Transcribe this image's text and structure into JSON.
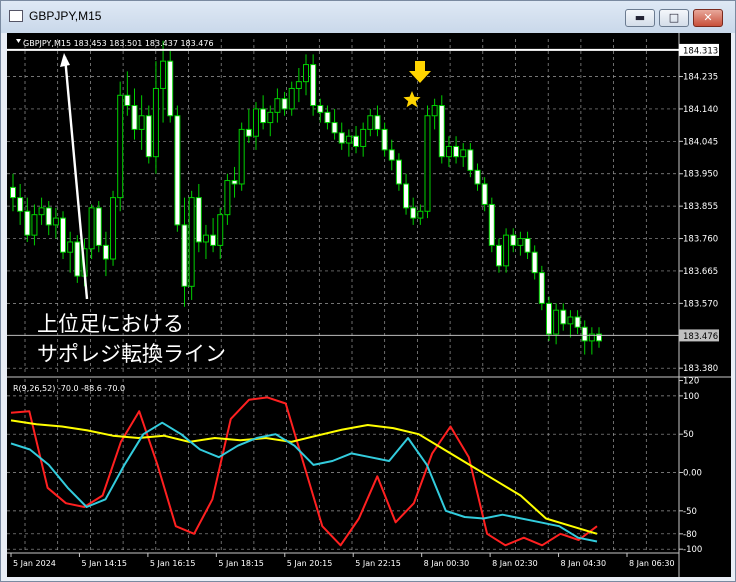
{
  "window": {
    "title": "GBPJPY,M15",
    "minimize_symbol": "▬",
    "maximize_symbol": "□",
    "close_symbol": "✕"
  },
  "chart_data": [
    {
      "type": "candlestick",
      "header": "GBPJPY,M15  183.453 183.501 183.437 183.476",
      "ylim": [
        183.36,
        184.345
      ],
      "y_ticks": [
        "184.235",
        "184.140",
        "184.045",
        "183.950",
        "183.855",
        "183.760",
        "183.665",
        "183.570",
        "183.380"
      ],
      "price_tags": [
        {
          "label": "184.313",
          "value": 184.313,
          "style": "highlight"
        },
        {
          "label": "183.476",
          "value": 183.476,
          "style": "current"
        }
      ],
      "annotation": {
        "line1": "上位足における",
        "line2": "サポレジ転換ライン"
      },
      "candles_ohlc": [
        [
          183.91,
          183.95,
          183.84,
          183.88
        ],
        [
          183.88,
          183.92,
          183.8,
          183.84
        ],
        [
          183.84,
          183.88,
          183.75,
          183.77
        ],
        [
          183.77,
          183.86,
          183.74,
          183.83
        ],
        [
          183.83,
          183.88,
          183.8,
          183.85
        ],
        [
          183.85,
          183.87,
          183.77,
          183.8
        ],
        [
          183.8,
          183.85,
          183.76,
          183.82
        ],
        [
          183.82,
          183.84,
          183.7,
          183.72
        ],
        [
          183.72,
          183.78,
          183.66,
          183.75
        ],
        [
          183.75,
          183.77,
          183.63,
          183.65
        ],
        [
          183.65,
          183.76,
          183.62,
          183.73
        ],
        [
          183.73,
          183.86,
          183.7,
          183.85
        ],
        [
          183.85,
          183.87,
          183.72,
          183.74
        ],
        [
          183.74,
          183.78,
          183.65,
          183.7
        ],
        [
          183.7,
          183.9,
          183.68,
          183.88
        ],
        [
          183.88,
          184.22,
          183.84,
          184.18
        ],
        [
          184.18,
          184.25,
          184.12,
          184.15
        ],
        [
          184.15,
          184.2,
          184.05,
          184.08
        ],
        [
          184.08,
          184.18,
          184.02,
          184.12
        ],
        [
          184.12,
          184.15,
          183.98,
          184.0
        ],
        [
          184.0,
          184.28,
          183.95,
          184.2
        ],
        [
          184.2,
          184.34,
          184.1,
          184.28
        ],
        [
          184.28,
          184.31,
          184.1,
          184.12
        ],
        [
          184.12,
          184.15,
          183.78,
          183.8
        ],
        [
          183.8,
          183.88,
          183.56,
          183.62
        ],
        [
          183.62,
          183.9,
          183.58,
          183.88
        ],
        [
          183.88,
          183.92,
          183.72,
          183.75
        ],
        [
          183.75,
          183.8,
          183.7,
          183.77
        ],
        [
          183.77,
          183.82,
          183.72,
          183.74
        ],
        [
          183.74,
          183.85,
          183.7,
          183.83
        ],
        [
          183.83,
          183.95,
          183.8,
          183.93
        ],
        [
          183.93,
          183.97,
          183.88,
          183.92
        ],
        [
          183.92,
          184.1,
          183.9,
          184.08
        ],
        [
          184.08,
          184.14,
          184.04,
          184.06
        ],
        [
          184.06,
          184.16,
          184.02,
          184.14
        ],
        [
          184.14,
          184.18,
          184.08,
          184.1
        ],
        [
          184.1,
          184.15,
          184.06,
          184.13
        ],
        [
          184.13,
          184.2,
          184.1,
          184.17
        ],
        [
          184.17,
          184.19,
          184.12,
          184.14
        ],
        [
          184.14,
          184.22,
          184.12,
          184.2
        ],
        [
          184.2,
          184.26,
          184.16,
          184.22
        ],
        [
          184.22,
          184.3,
          184.18,
          184.27
        ],
        [
          184.27,
          184.3,
          184.12,
          184.15
        ],
        [
          184.15,
          184.17,
          184.1,
          184.13
        ],
        [
          184.13,
          184.15,
          184.08,
          184.1
        ],
        [
          184.1,
          184.14,
          184.05,
          184.07
        ],
        [
          184.07,
          184.1,
          184.02,
          184.04
        ],
        [
          184.04,
          184.08,
          184.0,
          184.06
        ],
        [
          184.06,
          184.09,
          184.01,
          184.03
        ],
        [
          184.03,
          184.1,
          184.0,
          184.08
        ],
        [
          184.08,
          184.14,
          184.06,
          184.12
        ],
        [
          184.12,
          184.15,
          184.06,
          184.08
        ],
        [
          184.08,
          184.1,
          184.0,
          184.02
        ],
        [
          184.02,
          184.05,
          183.96,
          183.99
        ],
        [
          183.99,
          184.01,
          183.9,
          183.92
        ],
        [
          183.92,
          183.95,
          183.83,
          183.85
        ],
        [
          183.85,
          183.88,
          183.8,
          183.82
        ],
        [
          183.82,
          183.86,
          183.8,
          183.84
        ],
        [
          183.84,
          184.15,
          183.82,
          184.12
        ],
        [
          184.12,
          184.17,
          184.08,
          184.15
        ],
        [
          184.15,
          184.18,
          183.98,
          184.0
        ],
        [
          184.0,
          184.06,
          183.97,
          184.03
        ],
        [
          184.03,
          184.06,
          183.98,
          184.0
        ],
        [
          184.0,
          184.04,
          183.97,
          184.02
        ],
        [
          184.02,
          184.04,
          183.94,
          183.96
        ],
        [
          183.96,
          183.98,
          183.9,
          183.92
        ],
        [
          183.92,
          183.94,
          183.84,
          183.86
        ],
        [
          183.86,
          183.88,
          183.72,
          183.74
        ],
        [
          183.74,
          183.76,
          183.66,
          183.68
        ],
        [
          183.68,
          183.79,
          183.66,
          183.77
        ],
        [
          183.77,
          183.79,
          183.72,
          183.74
        ],
        [
          183.74,
          183.78,
          183.71,
          183.76
        ],
        [
          183.76,
          183.78,
          183.7,
          183.72
        ],
        [
          183.72,
          183.74,
          183.64,
          183.66
        ],
        [
          183.66,
          183.68,
          183.55,
          183.57
        ],
        [
          183.57,
          183.59,
          183.46,
          183.48
        ],
        [
          183.48,
          183.57,
          183.45,
          183.55
        ],
        [
          183.55,
          183.57,
          183.49,
          183.51
        ],
        [
          183.51,
          183.55,
          183.47,
          183.53
        ],
        [
          183.53,
          183.55,
          183.48,
          183.5
        ],
        [
          183.5,
          183.52,
          183.42,
          183.46
        ],
        [
          183.46,
          183.5,
          183.42,
          183.48
        ],
        [
          183.48,
          183.5,
          183.44,
          183.46
        ]
      ]
    },
    {
      "type": "line",
      "header": "R(9,26,52) -70.0 -88.6 -70.0",
      "ylim": [
        -105,
        122
      ],
      "y_ticks": [
        {
          "label": "120",
          "value": 120
        },
        {
          "label": "100",
          "value": 100
        },
        {
          "label": "50",
          "value": 50
        },
        {
          "label": "0.00",
          "value": 0
        },
        {
          "label": "-50",
          "value": -50
        },
        {
          "label": "-80",
          "value": -80
        },
        {
          "label": "-100",
          "value": -100
        }
      ],
      "x_labels": [
        "5 Jan 2024",
        "5 Jan 14:15",
        "5 Jan 16:15",
        "5 Jan 18:15",
        "5 Jan 20:15",
        "5 Jan 22:15",
        "8 Jan 00:30",
        "8 Jan 02:30",
        "8 Jan 04:30",
        "8 Jan 06:30"
      ],
      "series": [
        {
          "color": "#ff2020",
          "values": [
            78,
            80,
            -20,
            -40,
            -45,
            -30,
            40,
            80,
            10,
            -70,
            -80,
            -35,
            70,
            95,
            98,
            90,
            10,
            -70,
            -95,
            -60,
            -5,
            -65,
            -40,
            25,
            60,
            20,
            -80,
            -95,
            -85,
            -95,
            -80,
            -88,
            -70
          ]
        },
        {
          "color": "#ffff00",
          "values": [
            68,
            63,
            60,
            55,
            48,
            45,
            48,
            40,
            45,
            42,
            45,
            40,
            48,
            56,
            62,
            58,
            50,
            30,
            10,
            -10,
            -30,
            -60,
            -70,
            -80
          ]
        },
        {
          "color": "#33ccdd",
          "values": [
            38,
            30,
            10,
            -20,
            -45,
            -35,
            10,
            50,
            65,
            50,
            30,
            20,
            35,
            45,
            50,
            35,
            10,
            15,
            25,
            20,
            15,
            45,
            10,
            -50,
            -58,
            -60,
            -55,
            -60,
            -65,
            -70,
            -85,
            -90
          ]
        }
      ]
    }
  ]
}
